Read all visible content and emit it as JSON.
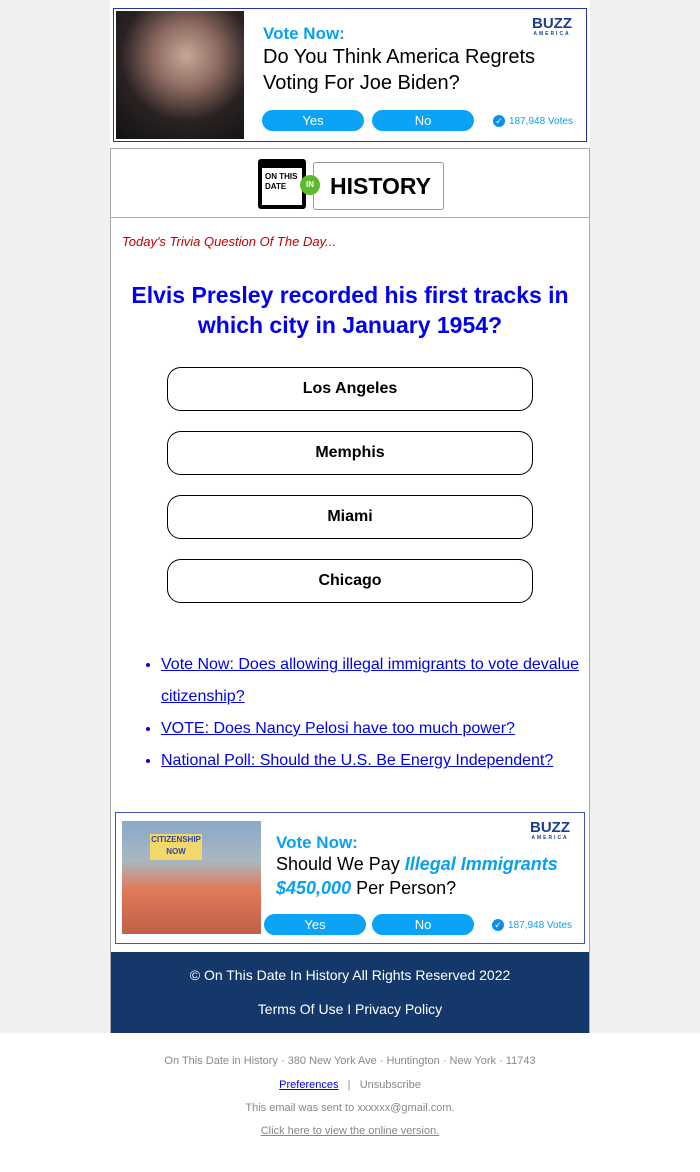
{
  "top_ad": {
    "vote_now": "Vote Now:",
    "question": "Do You Think America Regrets Voting For Joe Biden?",
    "yes": "Yes",
    "no": "No",
    "votes": "187,948 Votes",
    "brand": "BUZZ",
    "brand_sub": "AMERICA"
  },
  "logo": {
    "cal_text": "ON THIS DATE",
    "in": "IN",
    "history": "HISTORY"
  },
  "trivia_label": "Today's Trivia Question Of The Day...",
  "question": "Elvis Presley recorded his first tracks in which city in January 1954?",
  "answers": [
    "Los Angeles",
    "Memphis",
    "Miami",
    "Chicago"
  ],
  "links": [
    "Vote Now: Does allowing illegal immigrants to vote devalue citizenship?",
    "VOTE: Does Nancy Pelosi have too much power?",
    "National Poll: Should the U.S. Be Energy Independent?"
  ],
  "bottom_ad": {
    "vote_now": "Vote Now:",
    "q_part1": "Should We Pay ",
    "q_em1": "Illegal Immigrants",
    "q_em2": "$450,000",
    "q_part2": " Per Person?",
    "yes": "Yes",
    "no": "No",
    "votes": "187,948 Votes",
    "brand": "BUZZ",
    "brand_sub": "AMERICA",
    "sign_text": "CITIZENSHIP NOW"
  },
  "footer": {
    "copyright": "© On This Date In History All Rights Reserved 2022",
    "terms": "Terms Of Use",
    "sep": "I",
    "privacy": "Privacy Policy"
  },
  "email_footer": {
    "address": "On This Date in History · 380 New York Ave · Huntington · New York · 11743",
    "preferences": "Preferences",
    "pipe": "|",
    "unsubscribe": "Unsubscribe",
    "sent_to": "This email was sent to xxxxxx@gmail.com.",
    "online": "Click here to view the online version."
  },
  "colors": {
    "accent": "#0aa3f5",
    "question": "#0000ee",
    "footer_bg": "#15386a",
    "trivia": "#c00000"
  }
}
